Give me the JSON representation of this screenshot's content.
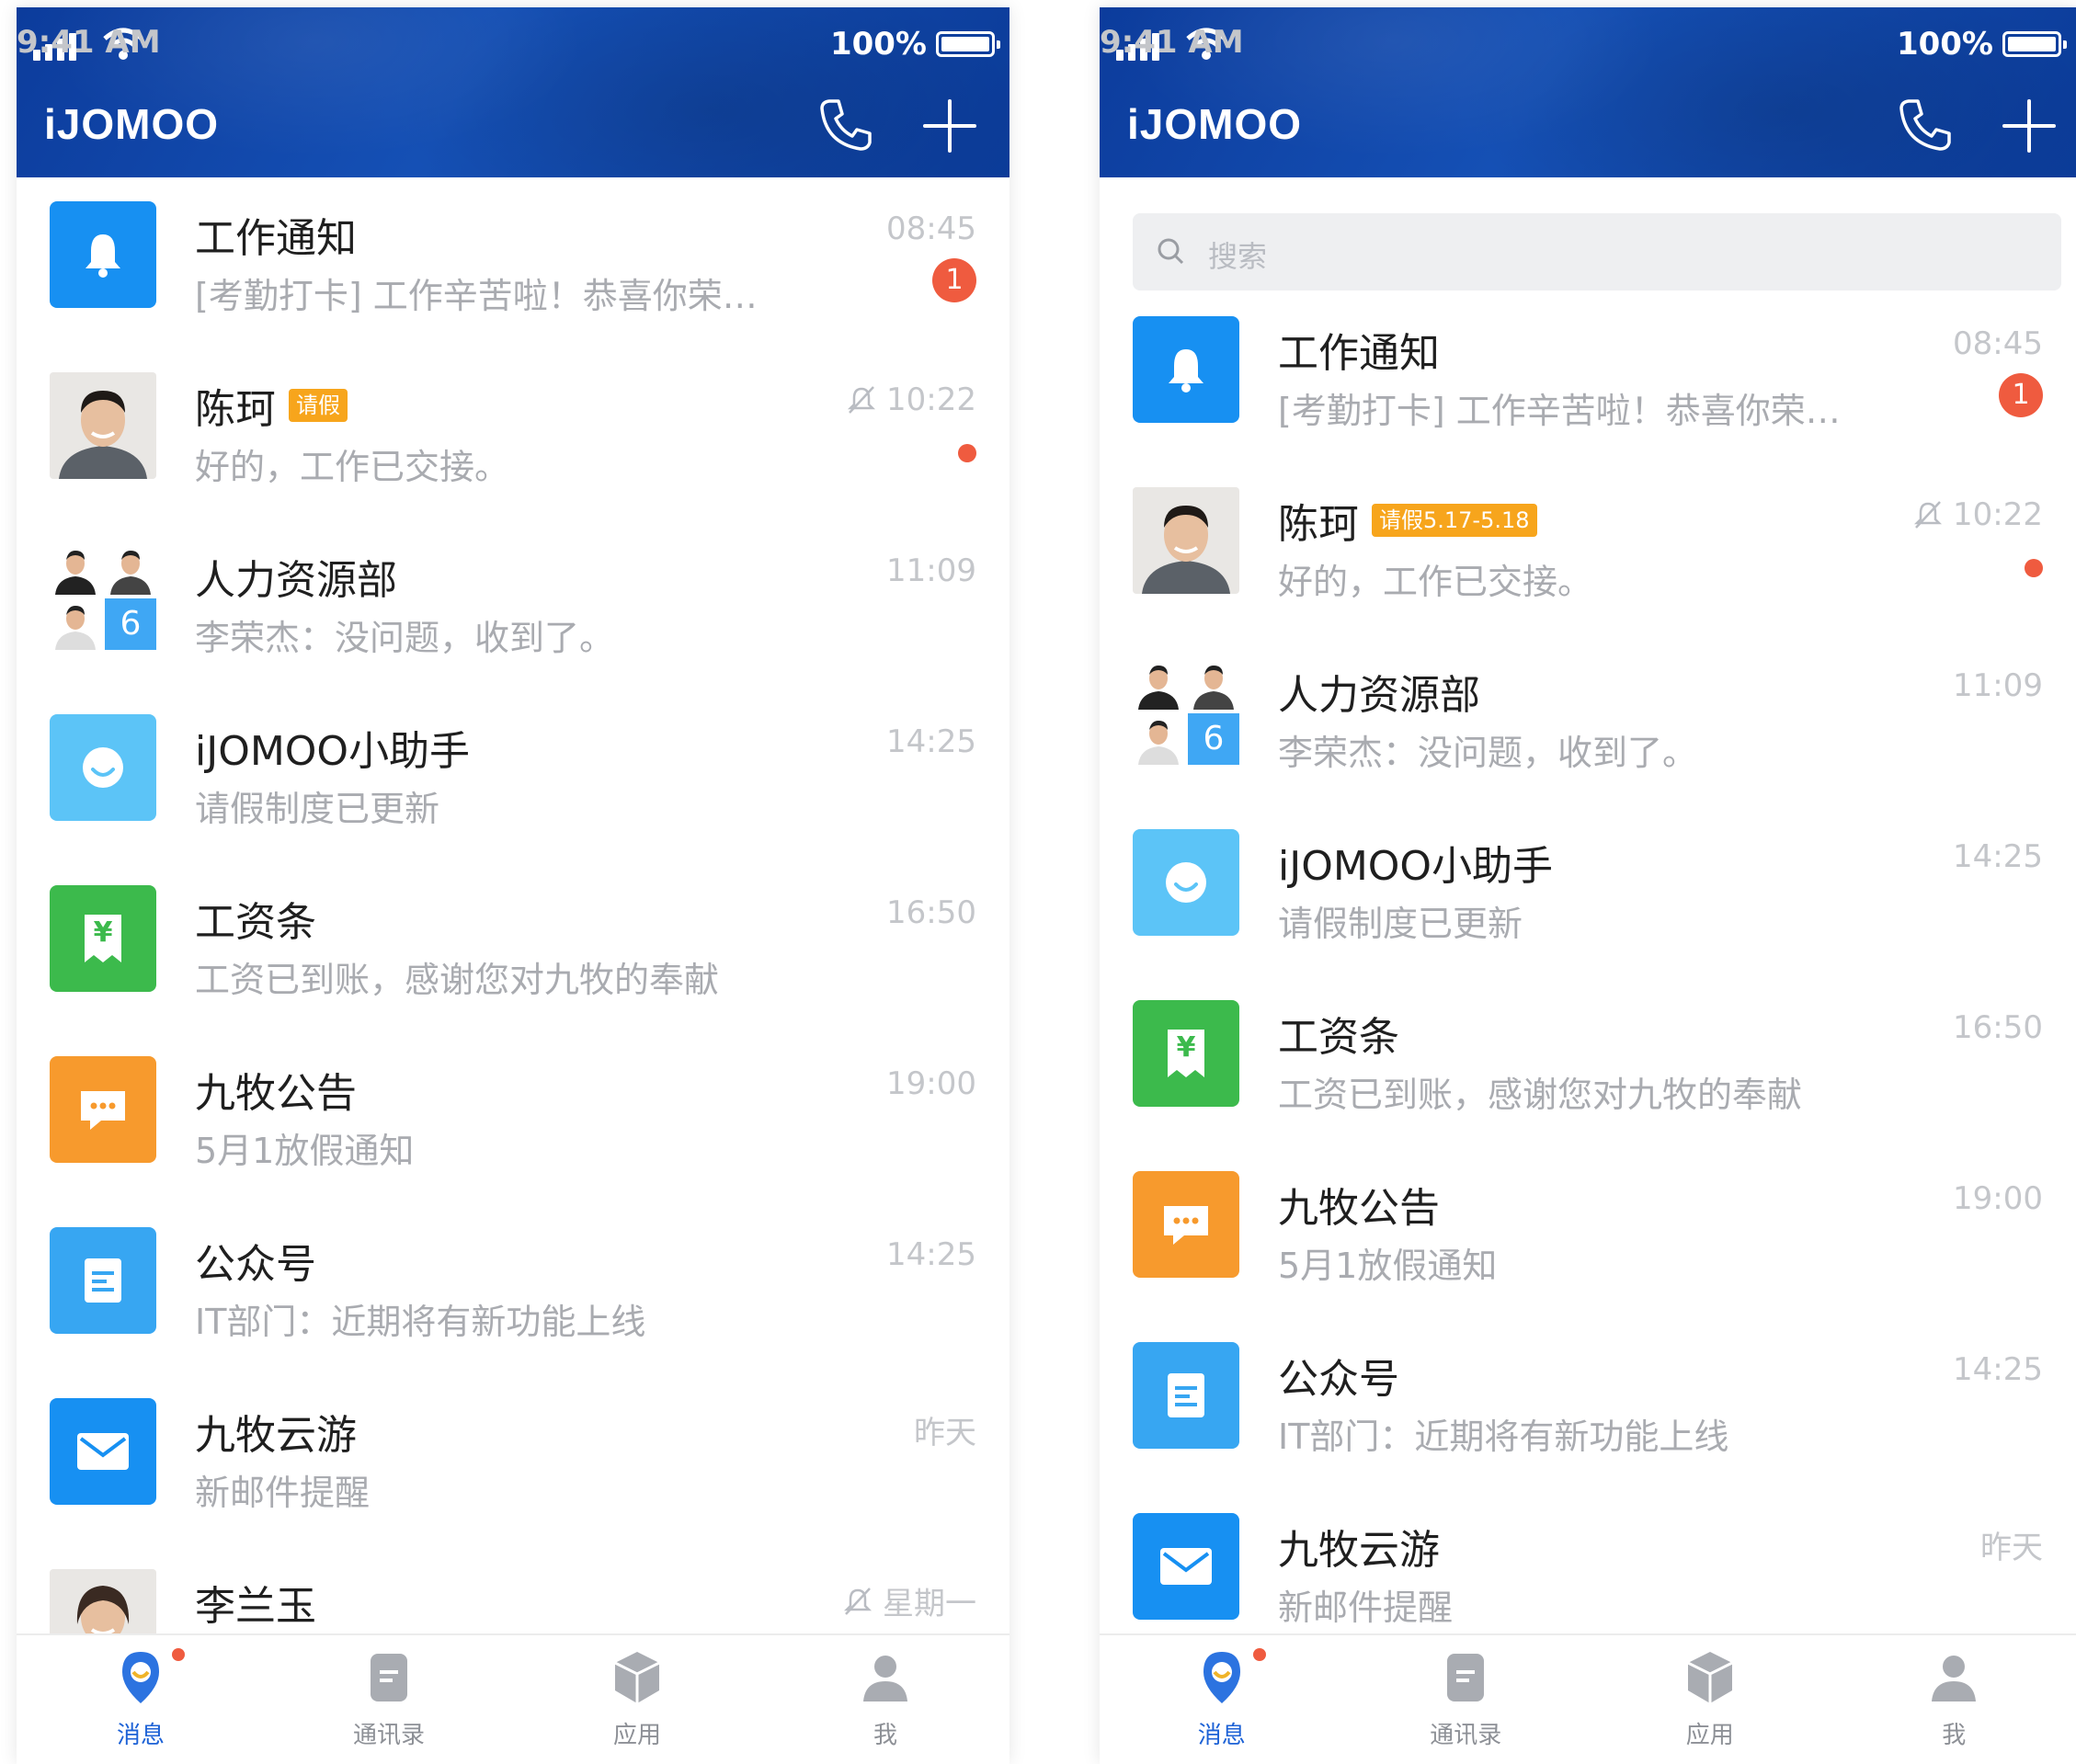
{
  "status": {
    "time": "9:41 AM",
    "battery": "100%"
  },
  "app": {
    "brand": "iJOMOO"
  },
  "search": {
    "placeholder": "搜索"
  },
  "colors": {
    "header": "#1550b5",
    "badge": "#ef5b3f",
    "tag": "#f7a51c",
    "active_tab": "#1d62d6"
  },
  "screens": [
    {
      "rows": [
        {
          "title": "工作通知",
          "preview": "[考勤打卡] 工作辛苦啦！恭喜你荣…",
          "time": "08:45",
          "badge": "1",
          "icon": "bell-icon"
        },
        {
          "title": "陈珂",
          "tag": "请假",
          "preview": "好的，工作已交接。",
          "time": "10:22",
          "muted": true,
          "icon": "person-avatar"
        },
        {
          "title": "人力资源部",
          "preview": "李荣杰：没问题，收到了。",
          "time": "11:09",
          "group_count": "6",
          "icon": "group-avatar"
        },
        {
          "title": "iJOMOO小助手",
          "preview": "请假制度已更新",
          "time": "14:25",
          "icon": "assistant-icon"
        },
        {
          "title": "工资条",
          "preview": "工资已到账，感谢您对九牧的奉献",
          "time": "16:50",
          "icon": "payslip-icon",
          "icon_glyph": "¥"
        },
        {
          "title": "九牧公告",
          "preview": "5月1放假通知",
          "time": "19:00",
          "icon": "announcement-icon"
        },
        {
          "title": "公众号",
          "preview": "IT部门：近期将有新功能上线",
          "time": "14:25",
          "icon": "official-account-icon"
        },
        {
          "title": "九牧云游",
          "preview": "新邮件提醒",
          "time": "昨天",
          "icon": "mail-icon"
        },
        {
          "title": "李兰玉",
          "preview": "",
          "time": "星期一",
          "muted": true,
          "icon": "person-avatar"
        }
      ]
    },
    {
      "rows": [
        {
          "title": "工作通知",
          "preview": "[考勤打卡] 工作辛苦啦！恭喜你荣…",
          "time": "08:45",
          "badge": "1",
          "icon": "bell-icon"
        },
        {
          "title": "陈珂",
          "tag": "请假5.17-5.18",
          "preview": "好的，工作已交接。",
          "time": "10:22",
          "muted": true,
          "icon": "person-avatar"
        },
        {
          "title": "人力资源部",
          "preview": "李荣杰：没问题，收到了。",
          "time": "11:09",
          "group_count": "6",
          "icon": "group-avatar"
        },
        {
          "title": "iJOMOO小助手",
          "preview": "请假制度已更新",
          "time": "14:25",
          "icon": "assistant-icon"
        },
        {
          "title": "工资条",
          "preview": "工资已到账，感谢您对九牧的奉献",
          "time": "16:50",
          "icon": "payslip-icon",
          "icon_glyph": "¥"
        },
        {
          "title": "九牧公告",
          "preview": "5月1放假通知",
          "time": "19:00",
          "icon": "announcement-icon"
        },
        {
          "title": "公众号",
          "preview": "IT部门：近期将有新功能上线",
          "time": "14:25",
          "icon": "official-account-icon"
        },
        {
          "title": "九牧云游",
          "preview": "新邮件提醒",
          "time": "昨天",
          "icon": "mail-icon"
        }
      ]
    }
  ],
  "tabs": [
    {
      "label": "消息",
      "icon": "message-icon",
      "active": true,
      "has_dot": true
    },
    {
      "label": "通讯录",
      "icon": "contacts-icon"
    },
    {
      "label": "应用",
      "icon": "apps-icon"
    },
    {
      "label": "我",
      "icon": "profile-icon"
    }
  ]
}
